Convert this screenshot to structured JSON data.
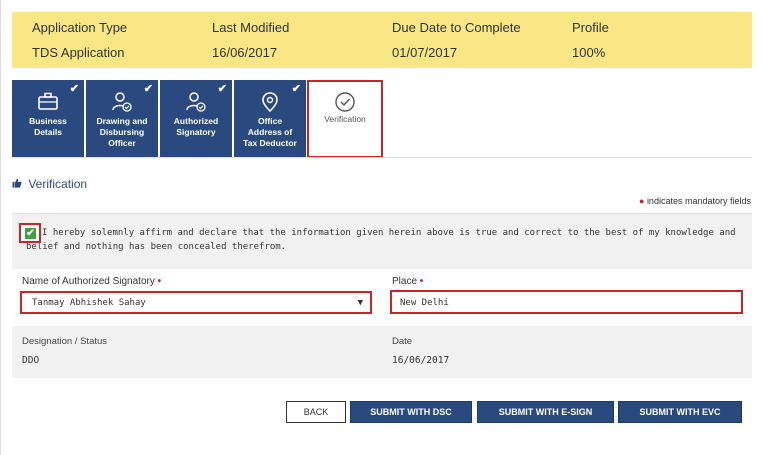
{
  "summary": {
    "application_type_label": "Application Type",
    "application_type_value": "TDS Application",
    "last_modified_label": "Last Modified",
    "last_modified_value": "16/06/2017",
    "due_date_label": "Due Date to Complete",
    "due_date_value": "01/07/2017",
    "profile_label": "Profile",
    "profile_value": "100%"
  },
  "tabs": [
    {
      "line1": "Business",
      "line2": "Details",
      "line3": "",
      "line4": "",
      "icon": "briefcase-icon",
      "completed": true
    },
    {
      "line1": "Drawing and",
      "line2": "Disbursing",
      "line3": "Officer",
      "line4": "",
      "icon": "user-check-icon",
      "completed": true
    },
    {
      "line1": "Authorized",
      "line2": "Signatory",
      "line3": "",
      "line4": "",
      "icon": "user-check-icon",
      "completed": true
    },
    {
      "line1": "Office",
      "line2": "Address of",
      "line3": "Tax Deductor",
      "line4": "",
      "icon": "location-pin-icon",
      "completed": true
    },
    {
      "line1": "Verification",
      "line2": "",
      "line3": "",
      "line4": "",
      "icon": "check-circle-icon",
      "completed": false,
      "active": true
    }
  ],
  "section": {
    "title": "Verification",
    "mandatory_note": "indicates mandatory fields"
  },
  "declaration": {
    "checked": true,
    "text": "I hereby solemnly affirm and declare that the information given herein above is true and correct to the best of my knowledge and belief and nothing has been concealed therefrom."
  },
  "form": {
    "signatory_label": "Name of Authorized Signatory",
    "signatory_value": "Tanmay Abhishek Sahay",
    "place_label": "Place",
    "place_value": "New Delhi",
    "designation_label": "Designation / Status",
    "designation_value": "DDO",
    "date_label": "Date",
    "date_value": "16/06/2017"
  },
  "buttons": {
    "back": "BACK",
    "submit_dsc": "SUBMIT WITH DSC",
    "submit_esign": "SUBMIT WITH E-SIGN",
    "submit_evc": "SUBMIT WITH EVC"
  },
  "colors": {
    "summary_bg": "#f8e784",
    "tab_bg": "#2a4a7f",
    "highlight": "#c9252c",
    "button_bg": "#2a4a7f"
  }
}
